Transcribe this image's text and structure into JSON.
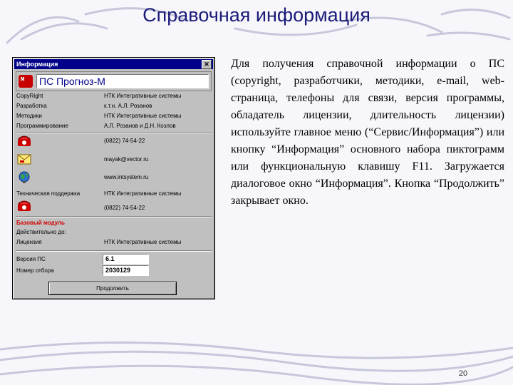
{
  "slide": {
    "title": "Справочная информация",
    "body": "Для получения справочной информации о ПС (copyright, разработчики, методики, e-mail, web-страница, телефоны для связи, версия программы, обладатель лицензии, длительность лицензии) используйте главное меню (“Сервис/Информация”) или кнопку “Информация” основного набора пиктограмм или функциональную клавишу F11. Загружается диалоговое окно “Информация”. Кнопка “Продолжить” закрывает окно.",
    "page_number": "20"
  },
  "dialog": {
    "title": "Информация",
    "close_glyph": "✕",
    "product": {
      "logo_text": "М",
      "name": "ПС Прогноз-М"
    },
    "info_rows": [
      {
        "label": "CopyRight",
        "value": "НТК Интегративные системы"
      },
      {
        "label": "Разработка",
        "value": "к.т.н. А.Л. Розанов"
      },
      {
        "label": "Методики",
        "value": "НТК Интегративные системы"
      },
      {
        "label": "Программирование",
        "value": "А.Л. Розанов и Д.Н. Козлов"
      }
    ],
    "contacts": {
      "phone": "(0822) 74-54-22",
      "email": "mayak@vector.ru",
      "web": "www.intsystem.ru"
    },
    "support": {
      "label": "Техническая поддержка",
      "value": "НТК Интегративные системы",
      "phone": "(0822) 74-54-22"
    },
    "license": {
      "header": "Базовый модуль",
      "valid_label": "Действительно до:",
      "license_label": "Лицензия",
      "license_value": "НТК Интегративные системы"
    },
    "version": {
      "label": "Версия ПС",
      "value": "6.1"
    },
    "build": {
      "label": "Номер отбора",
      "value": "2030129"
    },
    "continue_label": "Продолжить"
  },
  "colors": {
    "title": "#1a1a78",
    "dialog_titlebar": "#00008a",
    "dialog_face": "#c0c0c0",
    "accent_red": "#d00000"
  },
  "icons": [
    "phone-icon",
    "mail-icon",
    "globe-icon",
    "support-phone-icon"
  ]
}
